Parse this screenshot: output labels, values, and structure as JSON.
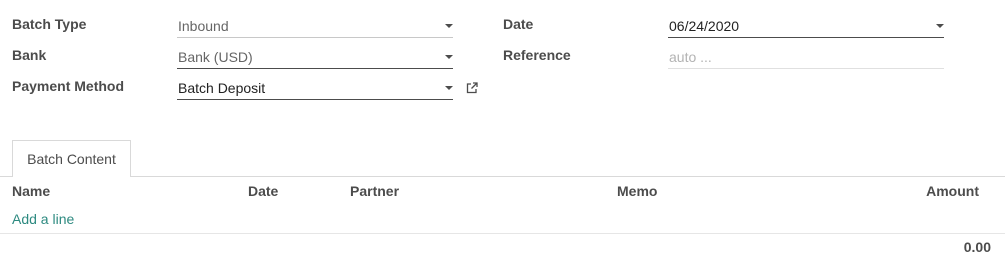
{
  "form": {
    "batch_type": {
      "label": "Batch Type",
      "value": "Inbound"
    },
    "bank": {
      "label": "Bank",
      "value": "Bank (USD)"
    },
    "payment_method": {
      "label": "Payment Method",
      "value": "Batch Deposit"
    },
    "date": {
      "label": "Date",
      "value": "06/24/2020"
    },
    "reference": {
      "label": "Reference",
      "placeholder": "auto ..."
    }
  },
  "tabs": [
    {
      "label": "Batch Content"
    }
  ],
  "table": {
    "columns": [
      "Name",
      "Date",
      "Partner",
      "Memo",
      "Amount"
    ],
    "add_line_label": "Add a line",
    "total": "0.00"
  },
  "colors": {
    "link": "#2d8a80",
    "text": "#4c4c4c",
    "placeholder": "#b3b3b3"
  }
}
